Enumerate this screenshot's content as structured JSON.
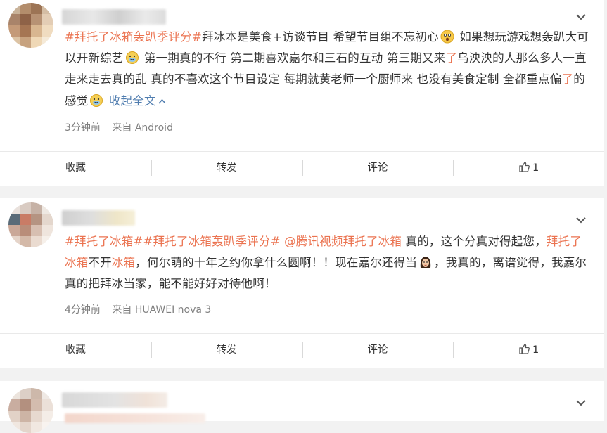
{
  "posts": [
    {
      "text_segments": [
        {
          "t": "#拜托了冰箱轰趴季评分#",
          "c": "link"
        },
        {
          "t": "拜冰本是美食+访谈节目 希望节目组不忘初心",
          "c": "plain"
        },
        {
          "t": "emoji",
          "c": "emoji",
          "icon": "surprised-face-icon"
        },
        {
          "t": " 如果想玩游戏想轰趴大可以开新综艺",
          "c": "plain"
        },
        {
          "t": "emoji",
          "c": "emoji",
          "icon": "doge-face-icon"
        },
        {
          "t": " 第一期真的不行 第二期喜欢嘉尔和三石的互动 第三期又来",
          "c": "plain"
        },
        {
          "t": "了",
          "c": "link"
        },
        {
          "t": "乌泱泱的人那么多人一直走来走去真的乱 真的不喜欢这个节目设定 每期就黄老师一个厨师来 也没有美食定制 全都重点偏",
          "c": "plain"
        },
        {
          "t": "了",
          "c": "link"
        },
        {
          "t": "的感觉",
          "c": "plain"
        },
        {
          "t": "emoji",
          "c": "emoji",
          "icon": "doge-face-icon"
        },
        {
          "t": " 收起全文",
          "c": "blue"
        }
      ],
      "time": "3分钟前",
      "source_prefix": "来自",
      "device": "Android",
      "actions": {
        "favorite": "收藏",
        "repost": "转发",
        "comment": "评论",
        "like_count": "1"
      }
    },
    {
      "text_segments": [
        {
          "t": "#拜托了冰箱##拜托了冰箱轰趴季评分#",
          "c": "link"
        },
        {
          "t": " ",
          "c": "plain"
        },
        {
          "t": "@腾讯视频",
          "c": "link"
        },
        {
          "t": "拜托了冰箱",
          "c": "link"
        },
        {
          "t": " 真的，这个分真对得起您，",
          "c": "plain"
        },
        {
          "t": "拜托了冰箱",
          "c": "link"
        },
        {
          "t": "不开",
          "c": "plain"
        },
        {
          "t": "冰箱",
          "c": "link"
        },
        {
          "t": "，何尔萌的十年之约你拿什么圆啊！！现在嘉尔还得当",
          "c": "plain"
        },
        {
          "t": "emoji",
          "c": "emoji",
          "icon": "girl-face-icon"
        },
        {
          "t": "，我真的，离谱觉得，我嘉尔真的把拜冰当家，能不能好好对待他啊！",
          "c": "plain"
        }
      ],
      "time": "4分钟前",
      "source_prefix": "来自",
      "device": "HUAWEI nova 3",
      "actions": {
        "favorite": "收藏",
        "repost": "转发",
        "comment": "评论",
        "like_count": "1"
      }
    }
  ],
  "colors": {
    "topic": "#eb7350",
    "link_blue": "#507daf",
    "meta": "#808080",
    "background": "#f2f2f2"
  }
}
